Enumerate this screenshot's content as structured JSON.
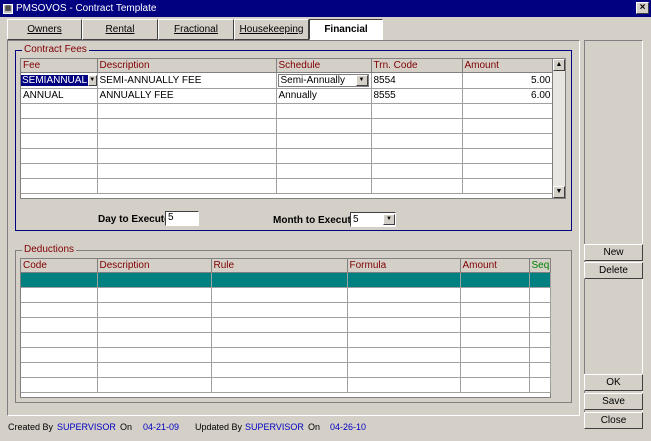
{
  "window": {
    "title": "PMSOVOS - Contract Template",
    "app_icon": "app-icon",
    "close_glyph": "×"
  },
  "tabs": [
    {
      "label": "Owners",
      "active": false
    },
    {
      "label": "Rental",
      "active": false
    },
    {
      "label": "Fractional",
      "active": false
    },
    {
      "label": "Housekeeping",
      "active": false
    },
    {
      "label": "Financial",
      "active": true
    }
  ],
  "contract_fees": {
    "title": "Contract Fees",
    "columns": [
      "Fee",
      "Description",
      "Schedule",
      "Trn. Code",
      "Amount"
    ],
    "rows": [
      {
        "fee": "SEMIANNUAL",
        "description": "SEMI-ANNUALLY FEE",
        "schedule": "Semi-Annually",
        "trn_code": "8554",
        "amount": "5.00"
      },
      {
        "fee": "ANNUAL",
        "description": "ANNUALLY FEE",
        "schedule": "Annually",
        "trn_code": "8555",
        "amount": "6.00"
      }
    ],
    "day_to_execute_label": "Day to Execute",
    "day_to_execute_value": "5",
    "month_to_execute_label": "Month to Execute",
    "month_to_execute_value": "5"
  },
  "deductions": {
    "title": "Deductions",
    "columns": [
      "Code",
      "Description",
      "Rule",
      "Formula",
      "Amount",
      "Seq."
    ]
  },
  "buttons": {
    "new": "New",
    "delete": "Delete",
    "ok": "OK",
    "save": "Save",
    "close": "Close"
  },
  "status_bar": {
    "created_by_label": "Created By",
    "created_by": "SUPERVISOR",
    "on_label": "On",
    "created_on": "04-21-09",
    "updated_by_label": "Updated By",
    "updated_by": "SUPERVISOR",
    "updated_on": "04-26-10"
  },
  "colors": {
    "title_bar": "#000080",
    "header_text": "#800000",
    "selected_row": "#008080",
    "status_value": "#0000c0",
    "seq_header": "#008000"
  }
}
